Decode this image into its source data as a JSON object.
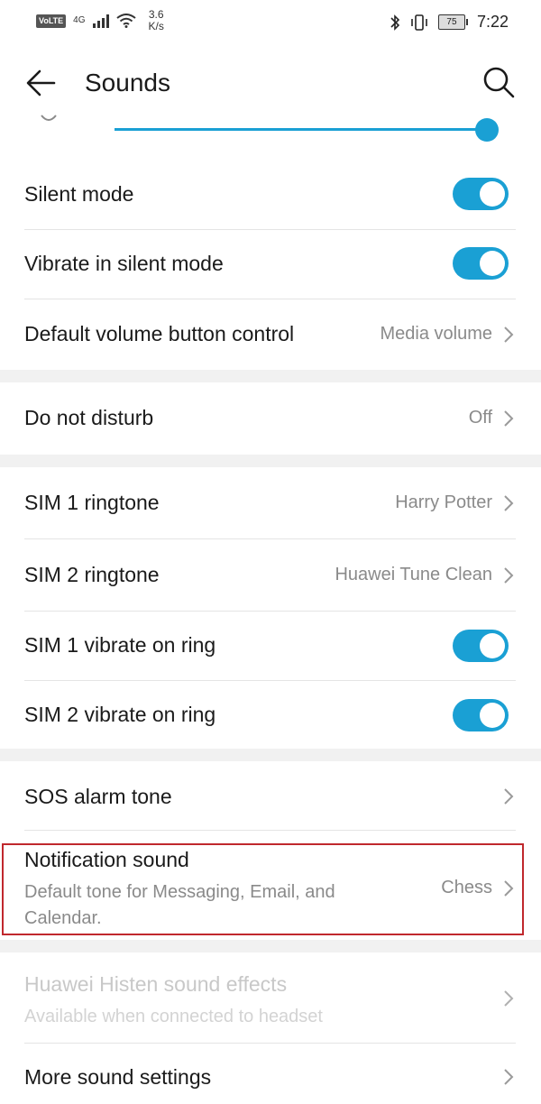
{
  "status_bar": {
    "volte": "VoLTE",
    "network": "4G",
    "speed_value": "3.6",
    "speed_unit": "K/s",
    "battery": "75",
    "time": "7:22"
  },
  "header": {
    "title": "Sounds"
  },
  "volume_slider": {
    "level_fraction": 0.98
  },
  "sections": {
    "silent_mode": {
      "label": "Silent mode",
      "enabled": true
    },
    "vibrate_silent": {
      "label": "Vibrate in silent mode",
      "enabled": true
    },
    "default_volume": {
      "label": "Default volume button control",
      "value": "Media volume"
    },
    "dnd": {
      "label": "Do not disturb",
      "value": "Off"
    },
    "sim1_ringtone": {
      "label": "SIM 1 ringtone",
      "value": "Harry Potter"
    },
    "sim2_ringtone": {
      "label": "SIM 2 ringtone",
      "value": "Huawei Tune Clean"
    },
    "sim1_vibrate": {
      "label": "SIM 1 vibrate on ring",
      "enabled": true
    },
    "sim2_vibrate": {
      "label": "SIM 2 vibrate on ring",
      "enabled": true
    },
    "sos_tone": {
      "label": "SOS alarm tone"
    },
    "notification_sound": {
      "label": "Notification sound",
      "subtitle_line1": "Default tone for Messaging, Email, and",
      "subtitle_line2": "Calendar.",
      "value": "Chess"
    },
    "histen": {
      "label": "Huawei Histen sound effects",
      "subtitle": "Available when connected to headset"
    },
    "more_settings": {
      "label": "More sound settings"
    }
  },
  "colors": {
    "accent": "#1aa0d4",
    "highlight_border": "#c0282d",
    "background": "#f1f1f1"
  }
}
